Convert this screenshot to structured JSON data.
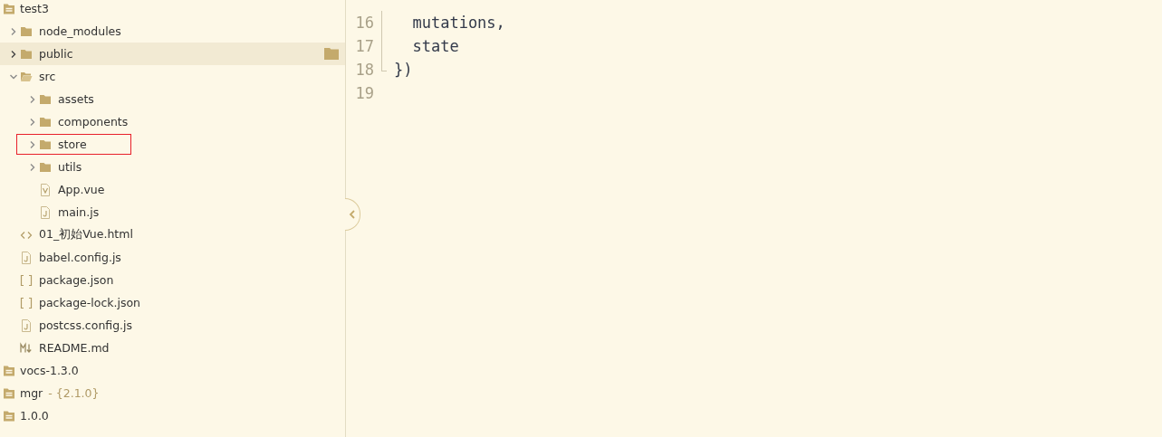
{
  "sidebar": {
    "tree": [
      {
        "name": "test3",
        "kind": "project",
        "children": [
          {
            "name": "node_modules",
            "kind": "folder",
            "expanded": false,
            "selected": false,
            "marked": false
          },
          {
            "name": "public",
            "kind": "folder",
            "expanded": false,
            "selected": true,
            "marked": false
          },
          {
            "name": "src",
            "kind": "folder",
            "expanded": true,
            "selected": false,
            "marked": false,
            "children": [
              {
                "name": "assets",
                "kind": "folder",
                "expanded": false,
                "selected": false,
                "marked": false
              },
              {
                "name": "components",
                "kind": "folder",
                "expanded": false,
                "selected": false,
                "marked": false
              },
              {
                "name": "store",
                "kind": "folder",
                "expanded": false,
                "selected": false,
                "marked": true
              },
              {
                "name": "utils",
                "kind": "folder",
                "expanded": false,
                "selected": false,
                "marked": false
              },
              {
                "name": "App.vue",
                "kind": "vue",
                "selected": false,
                "marked": false
              },
              {
                "name": "main.js",
                "kind": "js",
                "selected": false,
                "marked": false
              }
            ]
          },
          {
            "name": "01_初始Vue.html",
            "kind": "html",
            "selected": false,
            "marked": false
          },
          {
            "name": "babel.config.js",
            "kind": "js",
            "selected": false,
            "marked": false
          },
          {
            "name": "package.json",
            "kind": "json",
            "selected": false,
            "marked": false
          },
          {
            "name": "package-lock.json",
            "kind": "json",
            "selected": false,
            "marked": false
          },
          {
            "name": "postcss.config.js",
            "kind": "js",
            "selected": false,
            "marked": false
          },
          {
            "name": "README.md",
            "kind": "md",
            "selected": false,
            "marked": false
          }
        ]
      },
      {
        "name": "vocs-1.3.0",
        "kind": "project"
      },
      {
        "name": "mgr",
        "version": "- {2.1.0}",
        "kind": "project"
      },
      {
        "name": "1.0.0",
        "kind": "project"
      }
    ]
  },
  "editor": {
    "lines": [
      {
        "number": "16",
        "code": "  mutations,"
      },
      {
        "number": "17",
        "code": "  state"
      },
      {
        "number": "18",
        "code": "})",
        "fold_end": true
      },
      {
        "number": "19"
      }
    ]
  }
}
